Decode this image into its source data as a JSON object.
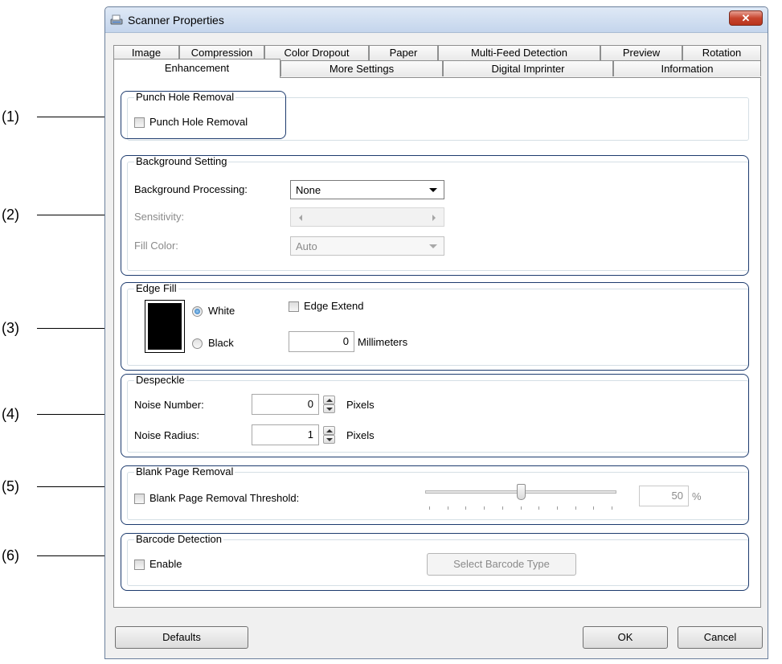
{
  "window": {
    "title": "Scanner Properties"
  },
  "tabs": {
    "row1": [
      "Image",
      "Compression",
      "Color Dropout",
      "Paper",
      "Multi-Feed Detection",
      "Preview",
      "Rotation"
    ],
    "row2": [
      "Enhancement",
      "More Settings",
      "Digital Imprinter",
      "Information"
    ],
    "active": "Enhancement"
  },
  "callouts": [
    "(1)",
    "(2)",
    "(3)",
    "(4)",
    "(5)",
    "(6)"
  ],
  "punch_hole": {
    "title": "Punch Hole Removal",
    "checkbox_label": "Punch Hole Removal",
    "checked": false
  },
  "background": {
    "title": "Background Setting",
    "processing_label": "Background Processing:",
    "processing_value": "None",
    "sensitivity_label": "Sensitivity:",
    "fill_color_label": "Fill Color:",
    "fill_color_value": "Auto"
  },
  "edge_fill": {
    "title": "Edge Fill",
    "white_label": "White",
    "black_label": "Black",
    "selected": "White",
    "edge_extend_label": "Edge Extend",
    "edge_extend_checked": false,
    "millimeters_value": "0",
    "millimeters_label": "Millimeters"
  },
  "despeckle": {
    "title": "Despeckle",
    "noise_number_label": "Noise Number:",
    "noise_number_value": "0",
    "noise_radius_label": "Noise Radius:",
    "noise_radius_value": "1",
    "unit": "Pixels"
  },
  "blank_page": {
    "title": "Blank Page Removal",
    "checkbox_label": "Blank Page Removal Threshold:",
    "checked": false,
    "threshold_value": "50",
    "threshold_percent": 50,
    "unit": "%"
  },
  "barcode": {
    "title": "Barcode Detection",
    "enable_label": "Enable",
    "checked": false,
    "select_button": "Select Barcode Type"
  },
  "footer": {
    "defaults": "Defaults",
    "ok": "OK",
    "cancel": "Cancel"
  },
  "colors": {
    "highlight": "#1d3b6e",
    "close_button": "#c7452e",
    "radio_dot": "#1c69b8"
  }
}
